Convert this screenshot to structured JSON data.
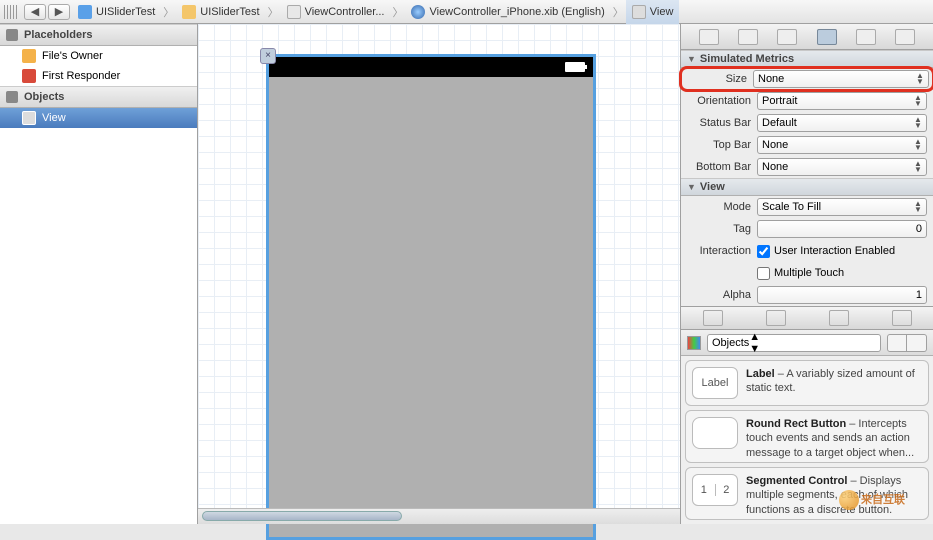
{
  "breadcrumb": {
    "project": "UISliderTest",
    "folder": "UISliderTest",
    "file": "ViewController...",
    "xib": "ViewController_iPhone.xib (English)",
    "view": "View"
  },
  "outline": {
    "placeholders_title": "Placeholders",
    "files_owner": "File's Owner",
    "first_responder": "First Responder",
    "objects_title": "Objects",
    "view_item": "View"
  },
  "inspector": {
    "simulated_metrics_title": "Simulated Metrics",
    "size_label": "Size",
    "size_value": "None",
    "orientation_label": "Orientation",
    "orientation_value": "Portrait",
    "statusbar_label": "Status Bar",
    "statusbar_value": "Default",
    "topbar_label": "Top Bar",
    "topbar_value": "None",
    "bottombar_label": "Bottom Bar",
    "bottombar_value": "None",
    "view_title": "View",
    "mode_label": "Mode",
    "mode_value": "Scale To Fill",
    "tag_label": "Tag",
    "tag_value": "0",
    "interaction_label": "Interaction",
    "user_interaction": "User Interaction Enabled",
    "multiple_touch": "Multiple Touch",
    "alpha_label": "Alpha",
    "alpha_value": "1"
  },
  "library": {
    "objects_label": "Objects",
    "label_name": "Label",
    "label_title": "Label",
    "label_desc": " – A variably sized amount of static text.",
    "button_title": "Round Rect Button",
    "button_desc": " – Intercepts touch events and sends an action message to a target object when...",
    "seg_title": "Segmented Control",
    "seg_desc": " – Displays multiple segments, each of which functions as a discrete button.",
    "seg_thumb1": "1",
    "seg_thumb2": "2"
  },
  "watermark": "来自互联"
}
